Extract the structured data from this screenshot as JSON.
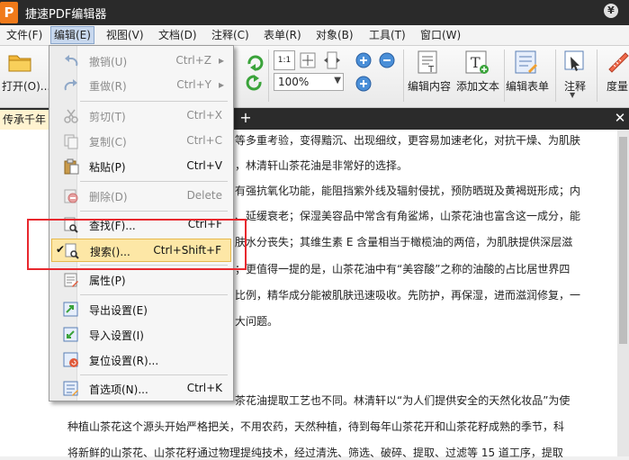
{
  "window": {
    "app_logo": "P",
    "title": "捷速PDF编辑器",
    "help_glyph": "¥"
  },
  "menubar": {
    "items": [
      {
        "label": "文件(F)"
      },
      {
        "label": "编辑(E)",
        "active": true
      },
      {
        "label": "视图(V)"
      },
      {
        "label": "文档(D)"
      },
      {
        "label": "注释(C)"
      },
      {
        "label": "表单(R)"
      },
      {
        "label": "对象(B)"
      },
      {
        "label": "工具(T)"
      },
      {
        "label": "窗口(W)"
      }
    ]
  },
  "toolbar": {
    "open_label": "打开(O)...",
    "zoom_value": "100%",
    "edit_content_label": "编辑内容",
    "add_text_label": "添加文本",
    "edit_form_label": "编辑表单",
    "annotate_label": "注释",
    "measure_label": "度量"
  },
  "tabs": {
    "doc_tab_label": "传承千年",
    "add_glyph": "+",
    "close_glyph": "✕"
  },
  "edit_menu": {
    "items": [
      {
        "label": "撤销(U)",
        "shortcut": "Ctrl+Z",
        "disabled": true,
        "icon": "undo-icon",
        "submenu": true
      },
      {
        "label": "重做(R)",
        "shortcut": "Ctrl+Y",
        "disabled": true,
        "icon": "redo-icon",
        "submenu": true
      },
      {
        "label": "剪切(T)",
        "shortcut": "Ctrl+X",
        "disabled": true,
        "icon": "scissors-icon"
      },
      {
        "label": "复制(C)",
        "shortcut": "Ctrl+C",
        "disabled": true,
        "icon": "copy-icon"
      },
      {
        "label": "粘贴(P)",
        "shortcut": "Ctrl+V",
        "disabled": false,
        "icon": "paste-icon"
      },
      {
        "label": "删除(D)",
        "shortcut": "Delete",
        "disabled": true,
        "icon": "delete-icon"
      },
      {
        "label": "查找(F)...",
        "shortcut": "Ctrl+F",
        "disabled": false,
        "icon": "find-icon"
      },
      {
        "label": "搜索()...",
        "shortcut": "Ctrl+Shift+F",
        "disabled": false,
        "icon": "search-icon",
        "highlight": true,
        "checked": true
      },
      {
        "label": "属性(P)",
        "shortcut": "",
        "disabled": false,
        "icon": "properties-icon"
      },
      {
        "label": "导出设置(E)",
        "shortcut": "",
        "disabled": false,
        "icon": "export-settings-icon"
      },
      {
        "label": "导入设置(I)",
        "shortcut": "",
        "disabled": false,
        "icon": "import-settings-icon"
      },
      {
        "label": "复位设置(R)...",
        "shortcut": "",
        "disabled": false,
        "icon": "reset-settings-icon"
      },
      {
        "label": "首选项(N)...",
        "shortcut": "Ctrl+K",
        "disabled": false,
        "icon": "preferences-icon"
      }
    ],
    "submenu_arrow": "▸",
    "check_glyph": "✔"
  },
  "document": {
    "lines": [
      "等多重考验，变得黯沉、出现细纹，更容易加速老化，对抗干燥、为肌肤",
      "，林清轩山茶花油是非常好的选择。",
      "有强抗氧化功能，能阻挡紫外线及辐射侵扰，预防晒斑及黄褐斑形成；内",
      "、延缓衰老；保湿美容品中常含有角鲨烯，山茶花油也富含这一成分，能",
      "肤水分丧失；其维生素 E 含量相当于橄榄油的两倍，为肌肤提供深层滋",
      "；更值得一提的是，山茶花油中有“美容酸”之称的油酸的占比居世界四",
      "比例，精华成分能被肌肤迅速吸收。先防护，再保湿，进而滋润修复，一",
      "大问题。",
      "茶花油提取工艺也不同。林清轩以“为人们提供安全的天然化妆品”为使",
      "种植山茶花这个源头开始严格把关，不用农药，天然种植，待到每年山茶花开和山茶花籽成熟的季节，科",
      "将新鲜的山茶花、山茶花籽通过物理提纯技术，经过清洗、筛选、破碎、提取、过滤等 15 道工序，提取"
    ]
  },
  "colors": {
    "title_bg": "#2a2a2a",
    "highlight_bg": "#fde7a6",
    "annotation_red": "#e8282e",
    "doc_tab_bg": "#fff3d0"
  }
}
